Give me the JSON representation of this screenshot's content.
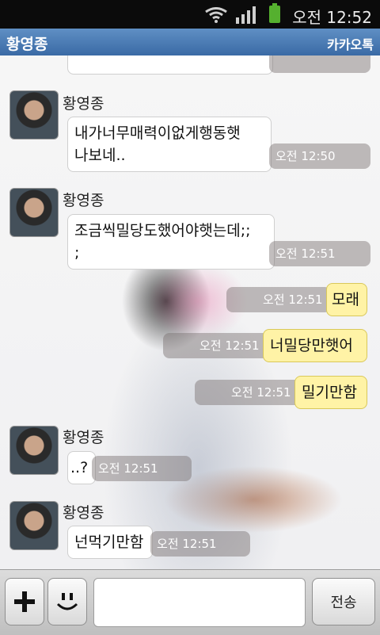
{
  "status": {
    "time": "오전 12:52"
  },
  "header": {
    "chat_name": "황영종",
    "app_name": "카카오톡"
  },
  "messages": [
    {
      "sender": "황영종",
      "text_line1": "내가너무매력이없게행동햇",
      "text_line2": "나보네..",
      "time": "오전 12:50"
    },
    {
      "sender": "황영종",
      "text_line1": "조금씩밀당도했어야햇는데;;",
      "text_line2": ";",
      "time": "오전 12:51"
    },
    {
      "text": "모래",
      "time": "오전 12:51"
    },
    {
      "text": "너밀당만햇어",
      "time": "오전 12:51"
    },
    {
      "text": "밀기만함",
      "time": "오전 12:51"
    },
    {
      "sender": "황영종",
      "text": "..?",
      "time": "오전 12:51"
    },
    {
      "sender": "황영종",
      "text": "넌먹기만함",
      "time": "오전 12:51"
    }
  ],
  "composer": {
    "send_label": "전송",
    "input_value": ""
  },
  "icons": [
    "wifi-icon",
    "signal-icon",
    "battery-icon",
    "plus-icon",
    "emoticon-icon"
  ]
}
